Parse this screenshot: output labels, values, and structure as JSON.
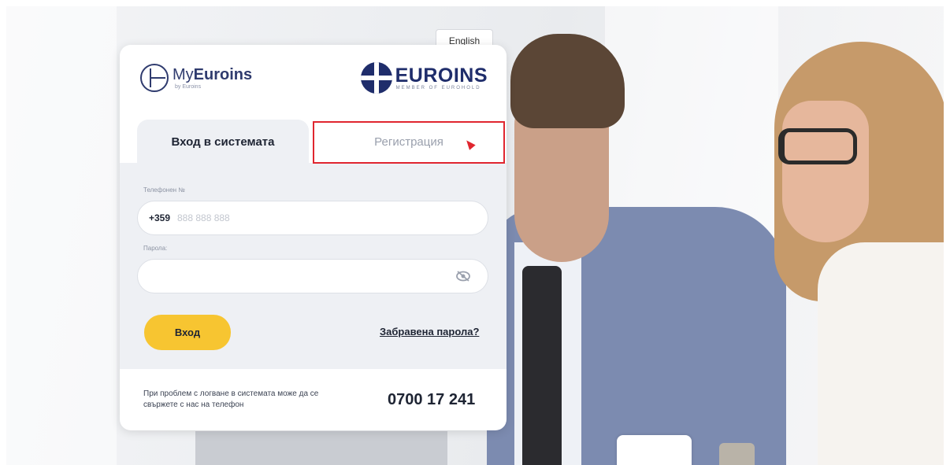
{
  "header": {
    "language_button": "English"
  },
  "logos": {
    "my_prefix": "My",
    "my_brand": "Euroins",
    "my_sub": "by Euroins",
    "euroins_name": "EUROINS",
    "euroins_member": "MEMBER OF EUROHOLD"
  },
  "tabs": {
    "login": "Вход в системата",
    "register": "Регистрация"
  },
  "form": {
    "phone_label": "Телефонен №",
    "phone_prefix": "+359",
    "phone_placeholder": "888 888 888",
    "password_label": "Парола:",
    "password_value": "",
    "login_button": "Вход",
    "forgot_link": "Забравена парола?"
  },
  "footer": {
    "help_text": "При проблем с логване в системата може да се свържете с нас на телефон",
    "help_phone": "0700 17 241"
  },
  "colors": {
    "accent_yellow": "#f7c531",
    "brand_navy": "#1f2d6b",
    "highlight_red": "#e0262f"
  }
}
